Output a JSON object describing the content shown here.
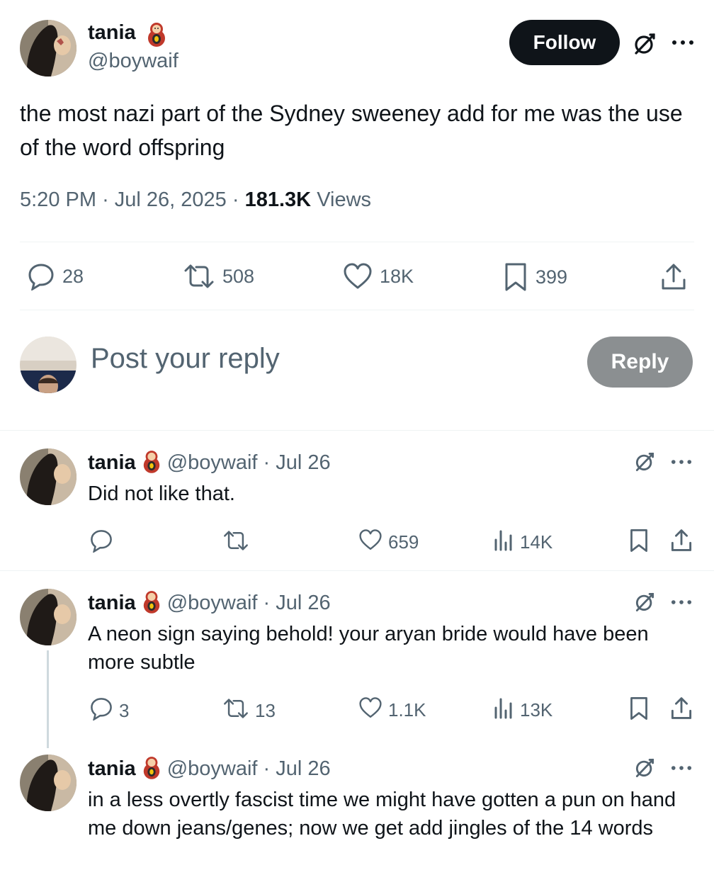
{
  "main_post": {
    "author_name": "tania",
    "author_handle": "@boywaif",
    "follow_label": "Follow",
    "text": "the most nazi part of the Sydney sweeney add for me was the use of the word offspring",
    "time": "5:20 PM",
    "date": "Jul 26, 2025",
    "views_count": "181.3K",
    "views_label": "Views",
    "sep": "·",
    "replies": "28",
    "reposts": "508",
    "likes": "18K",
    "bookmarks": "399"
  },
  "composer": {
    "placeholder": "Post your reply",
    "reply_label": "Reply"
  },
  "replies": [
    {
      "author_name": "tania",
      "handle_date": "@boywaif · Jul 26",
      "text": "Did not like that.",
      "replies": "",
      "reposts": "",
      "likes": "659",
      "views": "14K"
    },
    {
      "author_name": "tania",
      "handle_date": "@boywaif · Jul 26",
      "text": "A neon sign saying behold! your aryan bride would have been more subtle",
      "replies": "3",
      "reposts": "13",
      "likes": "1.1K",
      "views": "13K"
    },
    {
      "author_name": "tania",
      "handle_date": "@boywaif · Jul 26",
      "text": "in a less overtly fascist time we might have gotten a pun on hand me down jeans/genes; now we get add jingles of the 14 words"
    }
  ],
  "icons": {
    "reply": "reply-bubble-icon",
    "repost": "repost-icon",
    "like": "heart-icon",
    "bookmark": "bookmark-icon",
    "share": "share-icon",
    "views": "analytics-icon",
    "grok": "grok-icon",
    "more": "more-icon",
    "emoji": "matryoshka-doll-emoji"
  },
  "colors": {
    "text": "#0f1419",
    "muted": "#536471",
    "follow_bg": "#0f1419",
    "reply_btn_bg": "#8b8f91",
    "divider": "#eff3f4"
  }
}
